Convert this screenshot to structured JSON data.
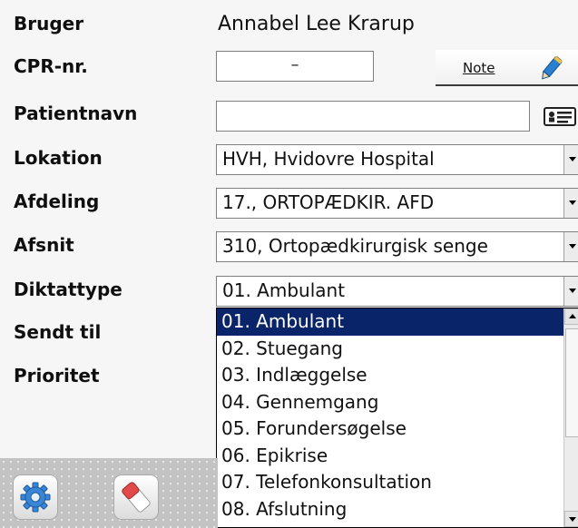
{
  "labels": {
    "bruger": "Bruger",
    "cpr": "CPR-nr.",
    "patientnavn": "Patientnavn",
    "lokation": "Lokation",
    "afdeling": "Afdeling",
    "afsnit": "Afsnit",
    "diktattype": "Diktattype",
    "sendt_til": "Sendt til",
    "prioritet": "Prioritet"
  },
  "user_name": "Annabel Lee Krarup",
  "cpr_value": "–",
  "note_label": "Note",
  "patient_name_value": "",
  "selects": {
    "lokation": "HVH, Hvidovre Hospital",
    "afdeling": "17., ORTOPÆDKIR. AFD",
    "afsnit": "310, Ortopædkirurgisk senge",
    "diktattype": "01. Ambulant"
  },
  "diktattype_options": [
    "01. Ambulant",
    "02. Stuegang",
    "03. Indlæggelse",
    "04. Gennemgang",
    "05. Forundersøgelse",
    "06. Epikrise",
    "07. Telefonkonsultation",
    "08. Afslutning"
  ],
  "selected_option_index": 0,
  "icons": {
    "note": "pencil-icon",
    "patient_lookup": "id-card-icon",
    "settings": "gear-icon",
    "clear": "eraser-icon"
  },
  "colors": {
    "selection": "#0a246a",
    "gear": "#3a86d6",
    "eraser": "#e04a4a",
    "pencil": "#2a7fd0"
  }
}
